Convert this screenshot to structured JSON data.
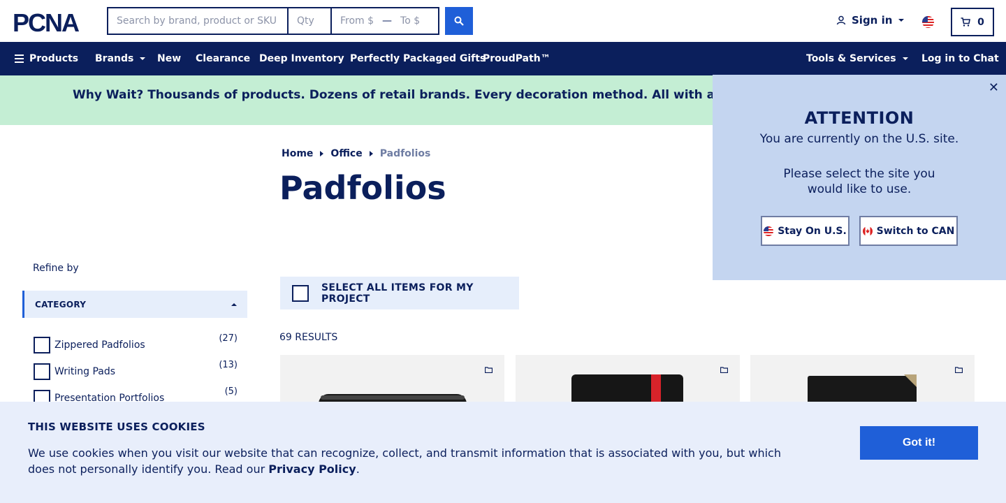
{
  "header": {
    "logo_text": "PCNA",
    "search_placeholder": "Search by brand, product or SKU",
    "qty_placeholder": "Qty",
    "price_from": "From $",
    "price_dash": "—",
    "price_to": "To $",
    "signin_label": "Sign in",
    "cart_count": "0"
  },
  "nav": {
    "products": "Products",
    "brands": "Brands",
    "new": "New",
    "clearance": "Clearance",
    "deep_inventory": "Deep Inventory",
    "gifts": "Perfectly Packaged Gifts",
    "proudpath": "ProudPath™",
    "tools": "Tools & Services",
    "chat": "Log in to Chat"
  },
  "promo": {
    "text": "Why Wait? Thousands of products. Dozens of retail brands. Every decoration method. All with a standard"
  },
  "breadcrumb": {
    "home": "Home",
    "office": "Office",
    "current": "Padfolios"
  },
  "page_title": "Padfolios",
  "sidebar": {
    "refine_label": "Refine by",
    "category_header": "CATEGORY",
    "categories": [
      {
        "label": "Zippered Padfolios",
        "count": "(27)"
      },
      {
        "label": "Writing Pads",
        "count": "(13)"
      },
      {
        "label": "Presentation Portfolios",
        "count": "(5)"
      }
    ]
  },
  "main": {
    "select_all_label": "SELECT ALL ITEMS FOR MY PROJECT",
    "results": "69 RESULTS"
  },
  "attention": {
    "title": "ATTENTION",
    "line1": "You are currently on the U.S. site.",
    "line2": "Please select the site you",
    "line3": "would like to use.",
    "stay_label": "Stay On U.S.",
    "switch_label": "Switch to CAN",
    "close_symbol": "✕"
  },
  "cookie": {
    "title": "THIS WEBSITE USES COOKIES",
    "text": "We use cookies when you visit our website that can recognize, collect, and transmit information that is associated with you, but which does not personally identify you. Read our",
    "link": "Privacy Policy",
    "period": ".",
    "button": "Got it!"
  },
  "colors": {
    "navy": "#0b1f5c",
    "blue": "#1f5fd8",
    "promo_bg": "#c4eed4",
    "attention_bg": "#c4d5f0",
    "cookie_bg": "#e8eefb"
  }
}
